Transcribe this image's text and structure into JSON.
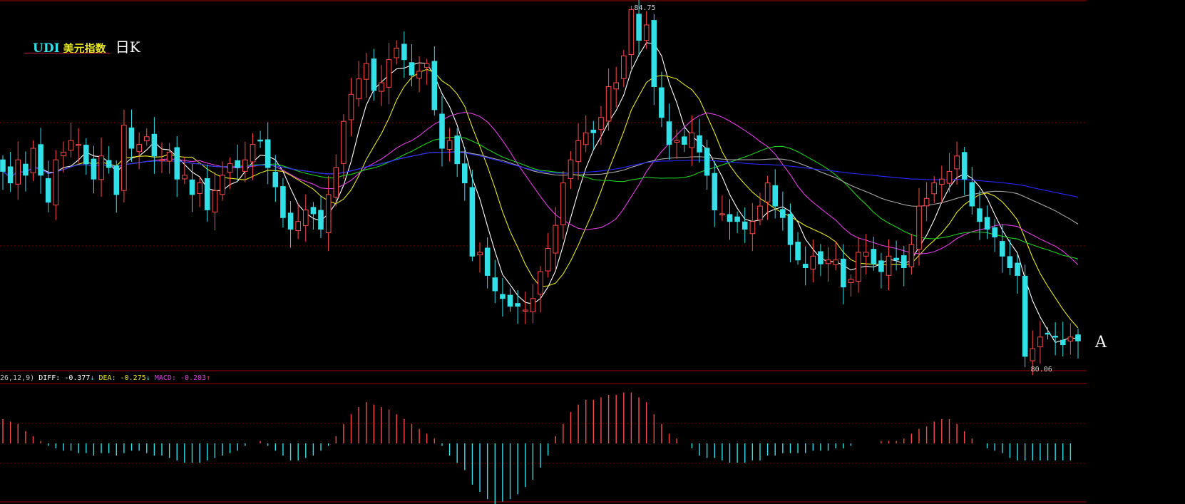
{
  "title": {
    "code": "UDI",
    "name": "美元指数",
    "period": "日K"
  },
  "marker": "A",
  "macd_info": {
    "params": "26,12,9)",
    "diff_label": "DIFF: ",
    "diff_value": "-0.377",
    "diff_arrow": "↓",
    "dea_label": "DEA: ",
    "dea_value": "-0.275",
    "dea_arrow": "↓",
    "macd_label": "MACD: ",
    "macd_value": "-0.203",
    "macd_arrow": "↑"
  },
  "colors": {
    "up": "#ff4a4a",
    "down": "#33e0e8",
    "ma5": "#ffffff",
    "ma10": "#e8e820",
    "ma20": "#e040e0",
    "ma30": "#20d020",
    "ma60": "#a8a8a8",
    "ma120": "#2828ff",
    "grid": "#7a0000",
    "diff": "#ffffff",
    "dea": "#e8e820"
  },
  "chart_data": [
    {
      "type": "candlestick",
      "title": "UDI 美元指数 日K",
      "ylim": [
        80.06,
        84.75
      ],
      "annotations": {
        "high": "84.75",
        "low": "80.06"
      },
      "closes": [
        82.6,
        82.45,
        82.75,
        82.55,
        82.9,
        82.55,
        82.2,
        82.75,
        82.85,
        83.0,
        82.95,
        82.7,
        82.5,
        82.8,
        82.65,
        82.3,
        83.2,
        82.9,
        82.95,
        83.05,
        82.8,
        82.75,
        82.85,
        82.5,
        82.55,
        82.3,
        82.45,
        82.1,
        82.35,
        82.55,
        82.7,
        82.65,
        82.75,
        82.95,
        83.0,
        82.65,
        82.4,
        82.0,
        81.85,
        81.95,
        82.1,
        82.05,
        81.85,
        82.3,
        82.65,
        83.25,
        83.6,
        83.8,
        84.0,
        83.65,
        83.75,
        84.05,
        84.2,
        84.05,
        83.85,
        83.9,
        84.0,
        83.4,
        82.9,
        83.0,
        82.7,
        82.45,
        81.5,
        81.55,
        81.25,
        81.05,
        80.95,
        80.85,
        80.85,
        80.8,
        80.95,
        81.3,
        81.6,
        81.9,
        82.45,
        82.75,
        83.0,
        83.1,
        83.1,
        83.3,
        83.7,
        83.75,
        84.1,
        84.7,
        84.3,
        84.5,
        83.7,
        83.3,
        82.95,
        83.0,
        82.95,
        83.1,
        82.85,
        82.55,
        82.1,
        82.05,
        81.95,
        81.95,
        81.85,
        81.95,
        82.15,
        82.45,
        82.15,
        82.0,
        81.65,
        81.45,
        81.35,
        81.5,
        81.4,
        81.45,
        81.45,
        81.1,
        81.2,
        81.55,
        81.55,
        81.4,
        81.3,
        81.5,
        81.45,
        81.35,
        81.65,
        82.15,
        82.25,
        82.45,
        82.5,
        82.6,
        82.8,
        82.5,
        82.15,
        81.95,
        81.85,
        81.75,
        81.5,
        81.35,
        81.25,
        80.2,
        80.3,
        80.45,
        80.5,
        80.45,
        80.35,
        80.45,
        80.4
      ],
      "macd_hist": [
        0.1,
        0.09,
        0.08,
        0.05,
        0.03,
        0.01,
        -0.01,
        -0.02,
        -0.03,
        -0.03,
        -0.04,
        -0.04,
        -0.05,
        -0.04,
        -0.04,
        -0.05,
        -0.04,
        -0.03,
        -0.03,
        -0.04,
        -0.05,
        -0.05,
        -0.06,
        -0.07,
        -0.08,
        -0.08,
        -0.08,
        -0.07,
        -0.06,
        -0.05,
        -0.04,
        -0.03,
        -0.01,
        0.0,
        0.01,
        -0.01,
        -0.03,
        -0.05,
        -0.07,
        -0.07,
        -0.06,
        -0.05,
        -0.03,
        -0.01,
        0.03,
        0.08,
        0.12,
        0.15,
        0.17,
        0.16,
        0.15,
        0.14,
        0.12,
        0.1,
        0.08,
        0.06,
        0.04,
        0.02,
        -0.01,
        -0.05,
        -0.08,
        -0.11,
        -0.17,
        -0.2,
        -0.23,
        -0.25,
        -0.24,
        -0.23,
        -0.21,
        -0.18,
        -0.15,
        -0.1,
        -0.05,
        0.03,
        0.08,
        0.13,
        0.16,
        0.18,
        0.18,
        0.19,
        0.2,
        0.2,
        0.21,
        0.21,
        0.19,
        0.17,
        0.12,
        0.08,
        0.04,
        0.02,
        0.0,
        -0.02,
        -0.05,
        -0.06,
        -0.06,
        -0.07,
        -0.08,
        -0.08,
        -0.08,
        -0.07,
        -0.07,
        -0.05,
        -0.05,
        -0.04,
        -0.04,
        -0.04,
        -0.04,
        -0.03,
        -0.03,
        -0.03,
        -0.02,
        -0.02,
        -0.01,
        0.0,
        0.0,
        0.0,
        0.01,
        0.01,
        0.01,
        0.02,
        0.04,
        0.06,
        0.07,
        0.09,
        0.1,
        0.1,
        0.08,
        0.05,
        0.02,
        0.0,
        -0.02,
        -0.03,
        -0.04,
        -0.06,
        -0.07,
        -0.07,
        -0.07,
        -0.07,
        -0.07,
        -0.07,
        -0.07,
        -0.07
      ],
      "macd_dea_range": [
        -0.5,
        0.45
      ]
    }
  ]
}
